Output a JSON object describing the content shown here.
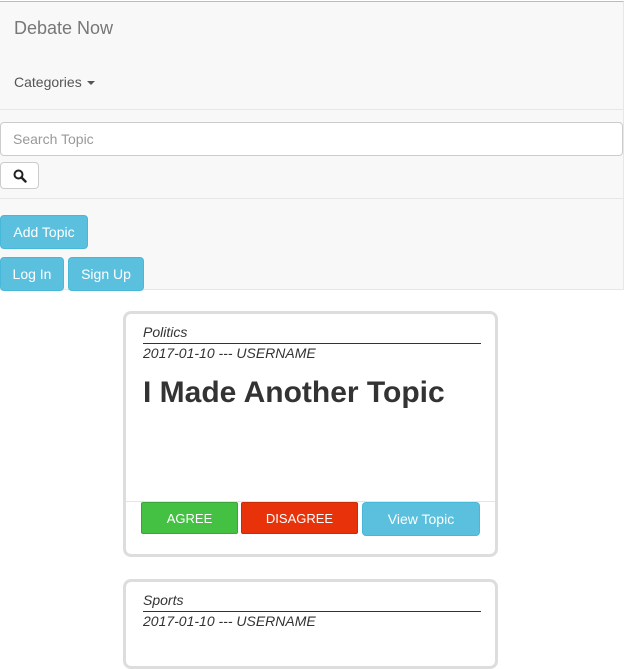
{
  "navbar": {
    "brand": "Debate Now",
    "categories_label": "Categories",
    "search_placeholder": "Search Topic",
    "add_topic_label": "Add Topic",
    "login_label": "Log In",
    "signup_label": "Sign Up"
  },
  "topics": [
    {
      "category": "Politics",
      "meta": "2017-01-10 --- USERNAME",
      "title": "I Made Another Topic",
      "agree_label": "AGREE",
      "disagree_label": "DISAGREE",
      "view_label": "View Topic"
    },
    {
      "category": "Sports",
      "meta": "2017-01-10 --- USERNAME"
    }
  ],
  "colors": {
    "agree": "#44c043",
    "disagree": "#e8330a",
    "info": "#5bc0de"
  }
}
